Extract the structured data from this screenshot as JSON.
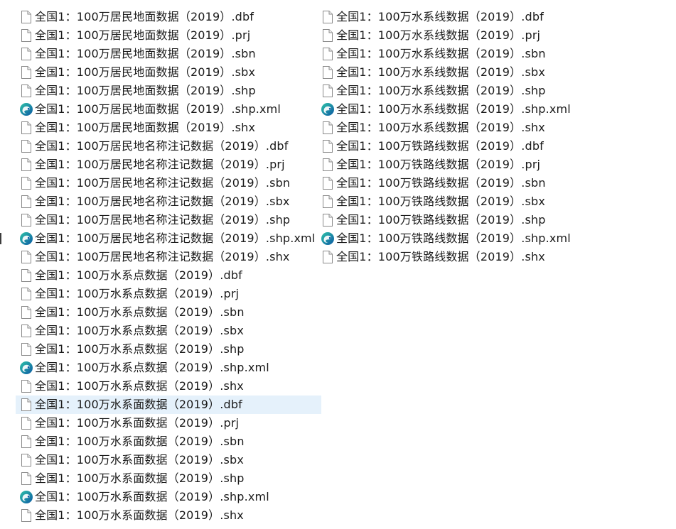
{
  "columns": {
    "left": [
      {
        "name": "全国1：100万居民地面数据（2019）.dbf",
        "icon": "file-icon"
      },
      {
        "name": "全国1：100万居民地面数据（2019）.prj",
        "icon": "file-icon"
      },
      {
        "name": "全国1：100万居民地面数据（2019）.sbn",
        "icon": "file-icon"
      },
      {
        "name": "全国1：100万居民地面数据（2019）.sbx",
        "icon": "file-icon"
      },
      {
        "name": "全国1：100万居民地面数据（2019）.shp",
        "icon": "file-icon"
      },
      {
        "name": "全国1：100万居民地面数据（2019）.shp.xml",
        "icon": "edge-icon"
      },
      {
        "name": "全国1：100万居民地面数据（2019）.shx",
        "icon": "file-icon"
      },
      {
        "name": "全国1：100万居民地名称注记数据（2019）.dbf",
        "icon": "file-icon"
      },
      {
        "name": "全国1：100万居民地名称注记数据（2019）.prj",
        "icon": "file-icon"
      },
      {
        "name": "全国1：100万居民地名称注记数据（2019）.sbn",
        "icon": "file-icon"
      },
      {
        "name": "全国1：100万居民地名称注记数据（2019）.sbx",
        "icon": "file-icon"
      },
      {
        "name": "全国1：100万居民地名称注记数据（2019）.shp",
        "icon": "file-icon"
      },
      {
        "name": "全国1：100万居民地名称注记数据（2019）.shp.xml",
        "icon": "edge-icon"
      },
      {
        "name": "全国1：100万居民地名称注记数据（2019）.shx",
        "icon": "file-icon"
      },
      {
        "name": "全国1：100万水系点数据（2019）.dbf",
        "icon": "file-icon"
      },
      {
        "name": "全国1：100万水系点数据（2019）.prj",
        "icon": "file-icon"
      },
      {
        "name": "全国1：100万水系点数据（2019）.sbn",
        "icon": "file-icon"
      },
      {
        "name": "全国1：100万水系点数据（2019）.sbx",
        "icon": "file-icon"
      },
      {
        "name": "全国1：100万水系点数据（2019）.shp",
        "icon": "file-icon"
      },
      {
        "name": "全国1：100万水系点数据（2019）.shp.xml",
        "icon": "edge-icon"
      },
      {
        "name": "全国1：100万水系点数据（2019）.shx",
        "icon": "file-icon"
      },
      {
        "name": "全国1：100万水系面数据（2019）.dbf",
        "icon": "file-icon",
        "selected": true
      },
      {
        "name": "全国1：100万水系面数据（2019）.prj",
        "icon": "file-icon"
      },
      {
        "name": "全国1：100万水系面数据（2019）.sbn",
        "icon": "file-icon"
      },
      {
        "name": "全国1：100万水系面数据（2019）.sbx",
        "icon": "file-icon"
      },
      {
        "name": "全国1：100万水系面数据（2019）.shp",
        "icon": "file-icon"
      },
      {
        "name": "全国1：100万水系面数据（2019）.shp.xml",
        "icon": "edge-icon"
      },
      {
        "name": "全国1：100万水系面数据（2019）.shx",
        "icon": "file-icon"
      }
    ],
    "right": [
      {
        "name": "全国1：100万水系线数据（2019）.dbf",
        "icon": "file-icon"
      },
      {
        "name": "全国1：100万水系线数据（2019）.prj",
        "icon": "file-icon"
      },
      {
        "name": "全国1：100万水系线数据（2019）.sbn",
        "icon": "file-icon"
      },
      {
        "name": "全国1：100万水系线数据（2019）.sbx",
        "icon": "file-icon"
      },
      {
        "name": "全国1：100万水系线数据（2019）.shp",
        "icon": "file-icon"
      },
      {
        "name": "全国1：100万水系线数据（2019）.shp.xml",
        "icon": "edge-icon"
      },
      {
        "name": "全国1：100万水系线数据（2019）.shx",
        "icon": "file-icon"
      },
      {
        "name": "全国1：100万铁路线数据（2019）.dbf",
        "icon": "file-icon"
      },
      {
        "name": "全国1：100万铁路线数据（2019）.prj",
        "icon": "file-icon"
      },
      {
        "name": "全国1：100万铁路线数据（2019）.sbn",
        "icon": "file-icon"
      },
      {
        "name": "全国1：100万铁路线数据（2019）.sbx",
        "icon": "file-icon"
      },
      {
        "name": "全国1：100万铁路线数据（2019）.shp",
        "icon": "file-icon"
      },
      {
        "name": "全国1：100万铁路线数据（2019）.shp.xml",
        "icon": "edge-icon"
      },
      {
        "name": "全国1：100万铁路线数据（2019）.shx",
        "icon": "file-icon"
      }
    ]
  },
  "colors": {
    "selection": "#e5f1fb",
    "text": "#1a1a1a",
    "edge_blue": "#0c59a4",
    "edge_teal": "#2ec3a8"
  }
}
